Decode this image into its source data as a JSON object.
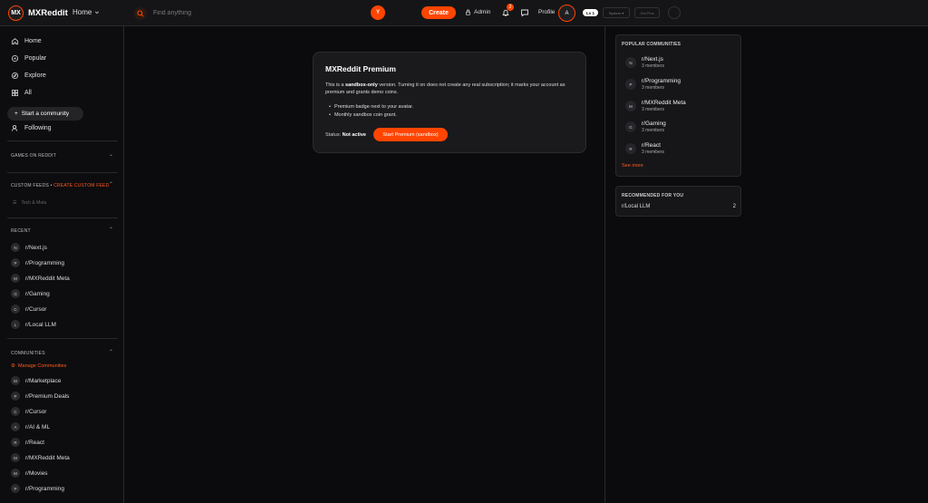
{
  "app": {
    "logo_mark": "MX",
    "name": "MXReddit",
    "home_label": "Home",
    "search_placeholder": "Find anything",
    "search_badge": "Y",
    "create_label": "Create",
    "admin_label": "Admin",
    "notification_count": "2",
    "profile_label": "Profile",
    "avatar_letter": "A",
    "level_label": "Lv 1",
    "system_label": "System",
    "get_plus_label": "Get Plus",
    "accent_color": "#ff4500"
  },
  "sidebar": {
    "nav": [
      {
        "label": "Home",
        "icon": "home-icon"
      },
      {
        "label": "Popular",
        "icon": "popular-icon"
      },
      {
        "label": "Explore",
        "icon": "explore-icon"
      },
      {
        "label": "All",
        "icon": "all-icon"
      }
    ],
    "start_community_label": "Start a community",
    "following_label": "Following",
    "games_header": "GAMES ON REDDIT",
    "custom_feeds_header": "CUSTOM FEEDS",
    "create_custom_feed": "CREATE CUSTOM FEED",
    "custom_feed_item": "Tech & Meta",
    "recent_header": "RECENT",
    "recent": [
      {
        "letter": "N",
        "name": "r/Next.js"
      },
      {
        "letter": "P",
        "name": "r/Programming"
      },
      {
        "letter": "M",
        "name": "r/MXReddit Meta"
      },
      {
        "letter": "G",
        "name": "r/Gaming"
      },
      {
        "letter": "C",
        "name": "r/Cursor"
      },
      {
        "letter": "L",
        "name": "r/Local LLM"
      }
    ],
    "communities_header": "COMMUNITIES",
    "manage_label": "Manage Communities",
    "communities": [
      {
        "letter": "M",
        "name": "r/Marketplace"
      },
      {
        "letter": "P",
        "name": "r/Premium Deals"
      },
      {
        "letter": "C",
        "name": "r/Cursor"
      },
      {
        "letter": "A",
        "name": "r/AI & ML"
      },
      {
        "letter": "R",
        "name": "r/React"
      },
      {
        "letter": "M",
        "name": "r/MXReddit Meta"
      },
      {
        "letter": "M",
        "name": "r/Movies"
      },
      {
        "letter": "P",
        "name": "r/Programming"
      }
    ]
  },
  "premium": {
    "title": "MXReddit Premium",
    "desc_pre": "This is a ",
    "desc_bold": "sandbox-only",
    "desc_post": " version. Turning it on does not create any real subscription; it marks your account as premium and grants demo coins.",
    "benefits": [
      "Premium badge next to your avatar.",
      "Monthly sandbox coin grant."
    ],
    "status_label": "Status:",
    "status_value": "Not active",
    "start_button": "Start Premium (sandbox)"
  },
  "right": {
    "popular_header": "POPULAR COMMUNITIES",
    "popular": [
      {
        "letter": "N",
        "name": "r/Next.js",
        "members": "3 members"
      },
      {
        "letter": "P",
        "name": "r/Programming",
        "members": "3 members"
      },
      {
        "letter": "M",
        "name": "r/MXReddit Meta",
        "members": "3 members"
      },
      {
        "letter": "G",
        "name": "r/Gaming",
        "members": "3 members"
      },
      {
        "letter": "R",
        "name": "r/React",
        "members": "3 members"
      }
    ],
    "see_more": "See more",
    "recommended_header": "RECOMMENDED FOR YOU",
    "recommended": [
      {
        "name": "r/Local LLM",
        "count": "2"
      }
    ]
  }
}
